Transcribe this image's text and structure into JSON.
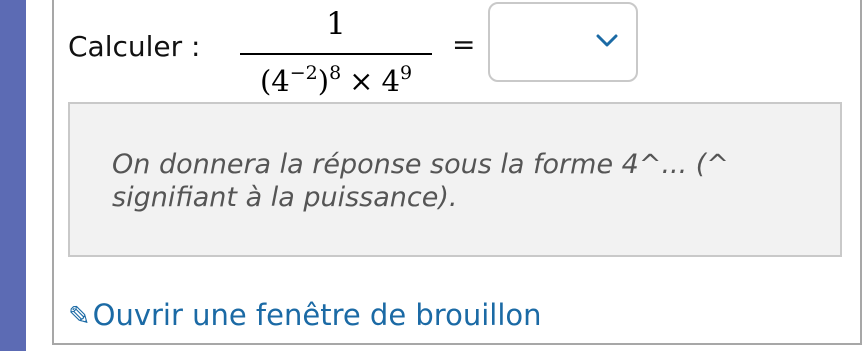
{
  "question": {
    "prompt_label": "Calculer :",
    "fraction": {
      "numerator": "1",
      "denominator": {
        "term1_base": "(4",
        "term1_exponent": "−2",
        "term1_close": ")",
        "term1_outer_exponent": "8",
        "operator": "×",
        "term2_base": "4",
        "term2_exponent": "9"
      }
    },
    "equals_sign": "=",
    "answer_dropdown": {
      "selected_value": "",
      "icon": "chevron-down-icon"
    }
  },
  "hint": {
    "text": "On donnera la réponse sous la forme 4^... (^ signifiant à la puissance)."
  },
  "draft_link": {
    "icon": "pencil-icon",
    "icon_glyph": "✎",
    "label": "Ouvrir une fenêtre de brouillon"
  },
  "colors": {
    "left_bar": "#5c6bb4",
    "link": "#1b6aa5",
    "hint_background": "#f2f2f2",
    "hint_text": "#555555",
    "chevron": "#1b6aa5"
  }
}
